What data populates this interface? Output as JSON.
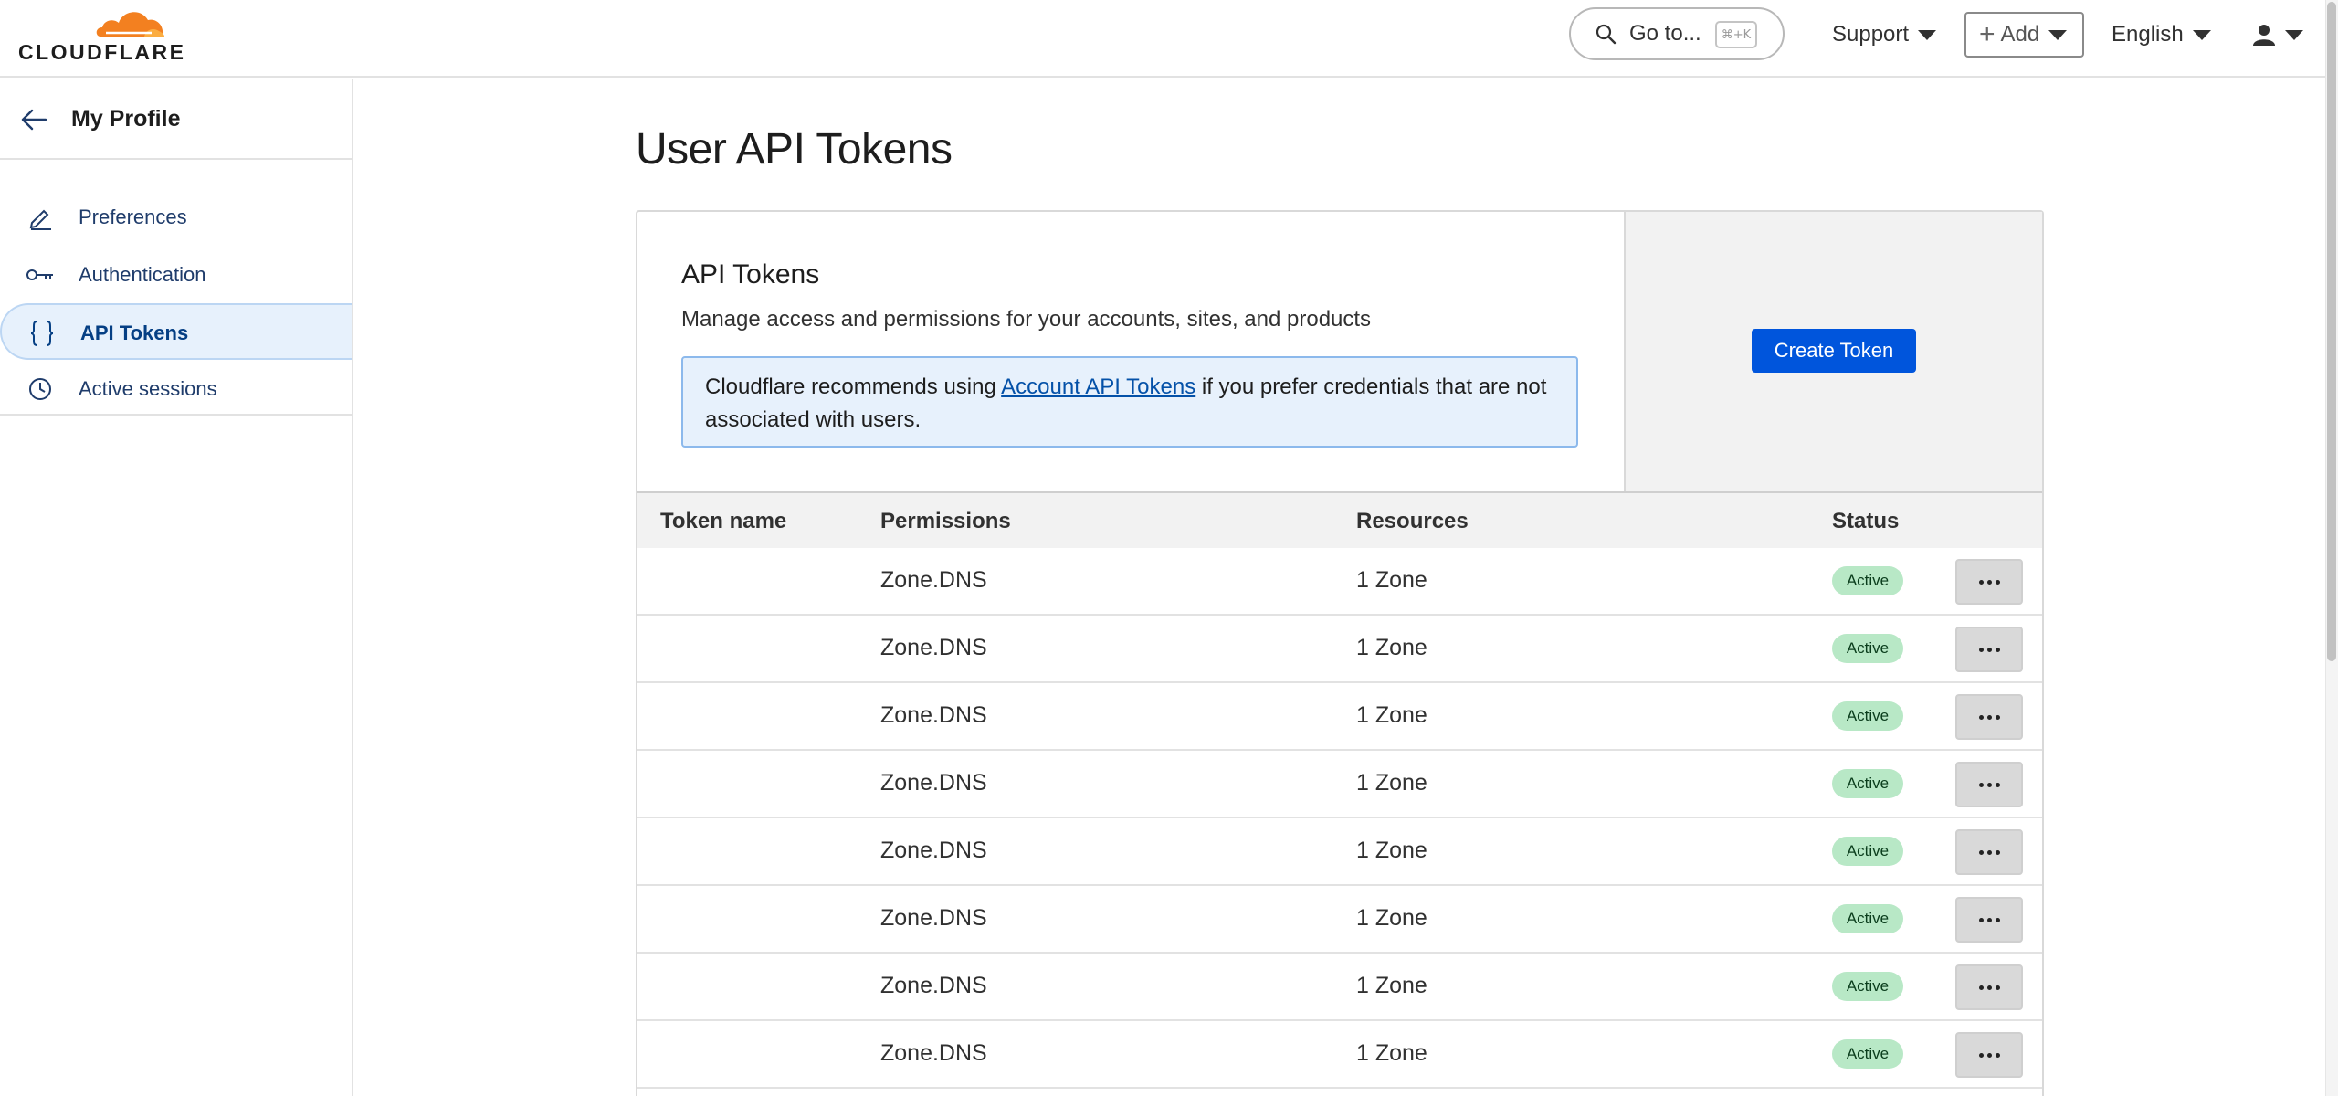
{
  "brand": {
    "name": "CLOUDFLARE",
    "accent": "#f38020"
  },
  "header": {
    "goto_label": "Go to...",
    "goto_shortcut": "⌘+K",
    "support_label": "Support",
    "add_label": "Add",
    "language_label": "English"
  },
  "sidebar": {
    "title": "My Profile",
    "items": [
      {
        "label": "Preferences",
        "icon": "pencil-icon",
        "active": false
      },
      {
        "label": "Authentication",
        "icon": "key-icon",
        "active": false
      },
      {
        "label": "API Tokens",
        "icon": "braces-icon",
        "active": true
      },
      {
        "label": "Active sessions",
        "icon": "clock-icon",
        "active": false
      }
    ]
  },
  "main": {
    "page_title": "User API Tokens",
    "section_title": "API Tokens",
    "section_desc": "Manage access and permissions for your accounts, sites, and products",
    "notice": {
      "prefix": "Cloudflare recommends using ",
      "link": "Account API Tokens",
      "suffix": " if you prefer credentials that are not associated with users."
    },
    "create_button": "Create Token",
    "table": {
      "headers": [
        "Token name",
        "Permissions",
        "Resources",
        "Status"
      ],
      "rows": [
        {
          "name": "",
          "permissions": "Zone.DNS",
          "resources": "1 Zone",
          "status": "Active"
        },
        {
          "name": "",
          "permissions": "Zone.DNS",
          "resources": "1 Zone",
          "status": "Active"
        },
        {
          "name": "",
          "permissions": "Zone.DNS",
          "resources": "1 Zone",
          "status": "Active"
        },
        {
          "name": "",
          "permissions": "Zone.DNS",
          "resources": "1 Zone",
          "status": "Active"
        },
        {
          "name": "",
          "permissions": "Zone.DNS",
          "resources": "1 Zone",
          "status": "Active"
        },
        {
          "name": "",
          "permissions": "Zone.DNS",
          "resources": "1 Zone",
          "status": "Active"
        },
        {
          "name": "",
          "permissions": "Zone.DNS",
          "resources": "1 Zone",
          "status": "Active"
        },
        {
          "name": "",
          "permissions": "Zone.DNS",
          "resources": "1 Zone",
          "status": "Active"
        }
      ]
    }
  },
  "colors": {
    "primary_button": "#0055dc",
    "active_badge": "#b8e8c6",
    "notice_bg": "#e7f1fc"
  }
}
